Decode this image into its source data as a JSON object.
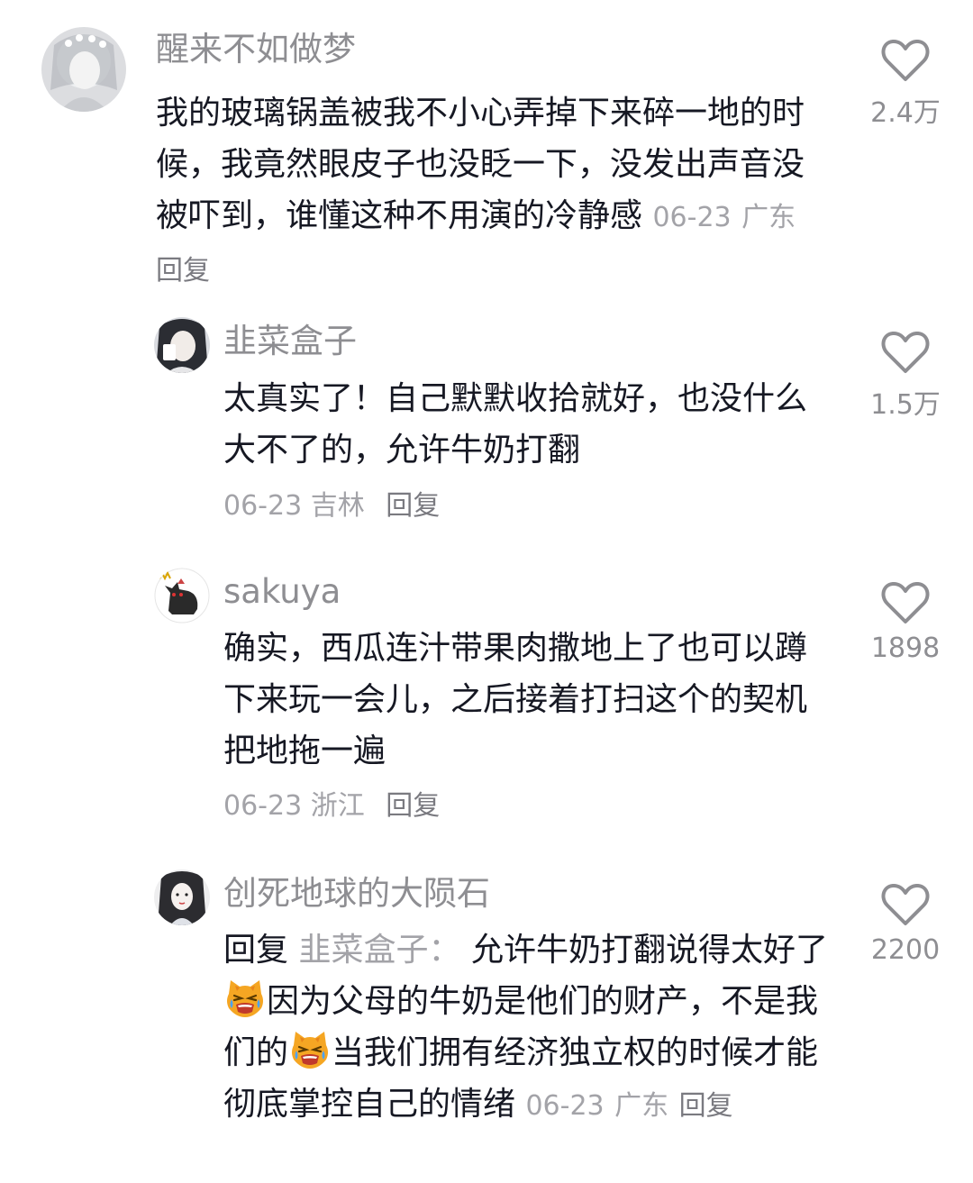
{
  "comments": [
    {
      "username": "醒来不如做梦",
      "text": "我的玻璃锅盖被我不小心弄掉下来碎一地的时候，我竟然眼皮子也没眨一下，没发出声音没被吓到，谁懂这种不用演的冷静感",
      "date": "06-23",
      "location": "广东",
      "reply_label": "回复",
      "likes": "2.4万"
    },
    {
      "username": "韭菜盒子",
      "text": "太真实了！自己默默收拾就好，也没什么大不了的，允许牛奶打翻",
      "date": "06-23",
      "location": "吉林",
      "reply_label": "回复",
      "likes": "1.5万"
    },
    {
      "username": "sakuya",
      "text": "确实，西瓜连汁带果肉撒地上了也可以蹲下来玩一会儿，之后接着打扫这个的契机把地拖一遍",
      "date": "06-23",
      "location": "浙江",
      "reply_label": "回复",
      "likes": "1898"
    },
    {
      "username": "创死地球的大陨石",
      "reply_prefix": "回复",
      "reply_to": "韭菜盒子：",
      "text_part1": "允许牛奶打翻说得太好了",
      "text_part2": "因为父母的牛奶是他们的财产，不是我们的",
      "text_part3": "当我们拥有经济独立权的时候才能彻底掌控自己的情绪",
      "emoji": "crying-cat-emoji",
      "date": "06-23",
      "location": "广东",
      "reply_label": "回复",
      "likes": "2200"
    }
  ]
}
